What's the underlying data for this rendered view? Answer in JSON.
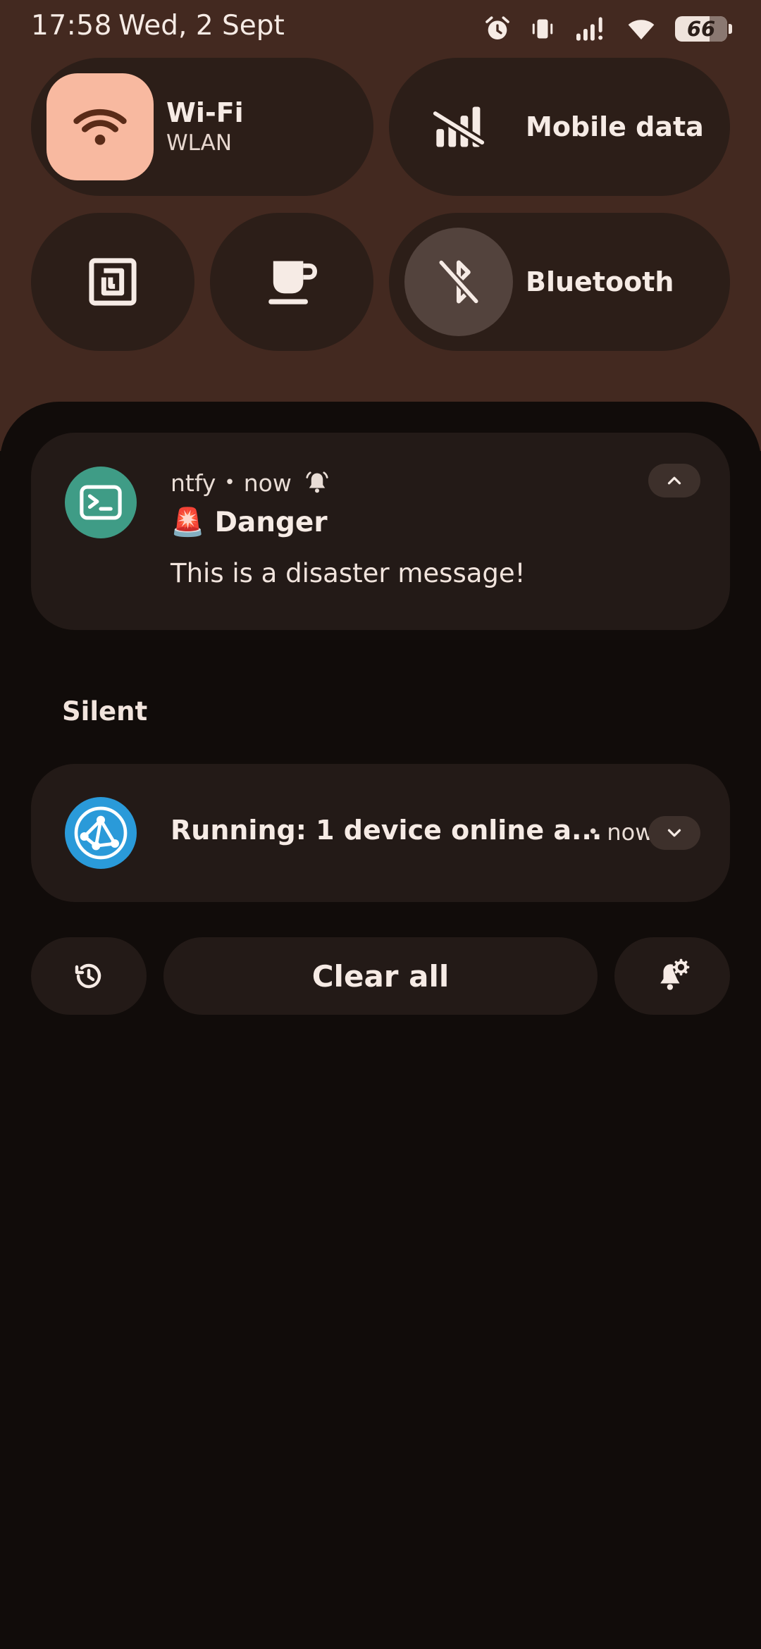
{
  "status_bar": {
    "time": "17:58",
    "date": "Wed, 2 Sept",
    "battery_level": "66",
    "icons": [
      "alarm-icon",
      "vibrate-icon",
      "signal-icon",
      "wifi-icon",
      "battery-icon"
    ]
  },
  "quick_settings": {
    "wifi": {
      "label": "Wi-Fi",
      "sub": "WLAN",
      "state": "on",
      "icon": "wifi-icon"
    },
    "mobile_data": {
      "label": "Mobile data",
      "state": "off",
      "icon": "mobile-data-off-icon"
    },
    "nfc": {
      "icon": "nfc-icon",
      "state": "off"
    },
    "caffeine": {
      "icon": "coffee-cup-icon",
      "state": "off"
    },
    "bluetooth": {
      "label": "Bluetooth",
      "state": "off",
      "icon": "bluetooth-off-icon"
    }
  },
  "notifications": {
    "alerting": [
      {
        "app": "ntfy",
        "time": "now",
        "title_emoji": "🚨",
        "title": "Danger",
        "body": "This is a disaster message!",
        "icon": "terminal-icon",
        "expanded": true
      }
    ],
    "silent_header": "Silent",
    "silent": [
      {
        "title": "Running: 1 device online a...",
        "time": "now",
        "icon": "network-graph-icon",
        "expanded": false
      }
    ]
  },
  "footer": {
    "clear_all_label": "Clear all",
    "history_icon": "history-icon",
    "settings_icon": "notification-settings-icon"
  },
  "colors": {
    "qs_background": "#432920",
    "tile_background": "#2c1e18",
    "wifi_active": "#f8b9a0",
    "shade_background": "#110c0a",
    "card_background": "#231a17",
    "ntfy_brand": "#3f9c86",
    "network_app_brand": "#2a9ad9"
  }
}
